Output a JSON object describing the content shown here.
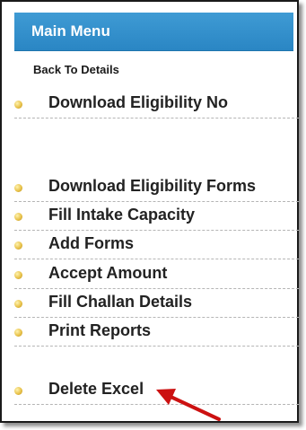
{
  "menu": {
    "header": "Main Menu",
    "back_link": "Back To Details",
    "items": [
      {
        "label": "Download Eligibility No"
      },
      {
        "label": "Download Eligibility Forms"
      },
      {
        "label": "Fill Intake Capacity"
      },
      {
        "label": "Add Forms"
      },
      {
        "label": "Accept Amount"
      },
      {
        "label": "Fill Challan Details"
      },
      {
        "label": "Print Reports"
      },
      {
        "label": "Delete Excel"
      }
    ]
  },
  "colors": {
    "header_bg": "#2a86c4",
    "bullet": "#e8c24a",
    "arrow": "#cc1111"
  },
  "icons": {
    "bullet": "bullet-icon",
    "annotation": "arrow-icon"
  }
}
